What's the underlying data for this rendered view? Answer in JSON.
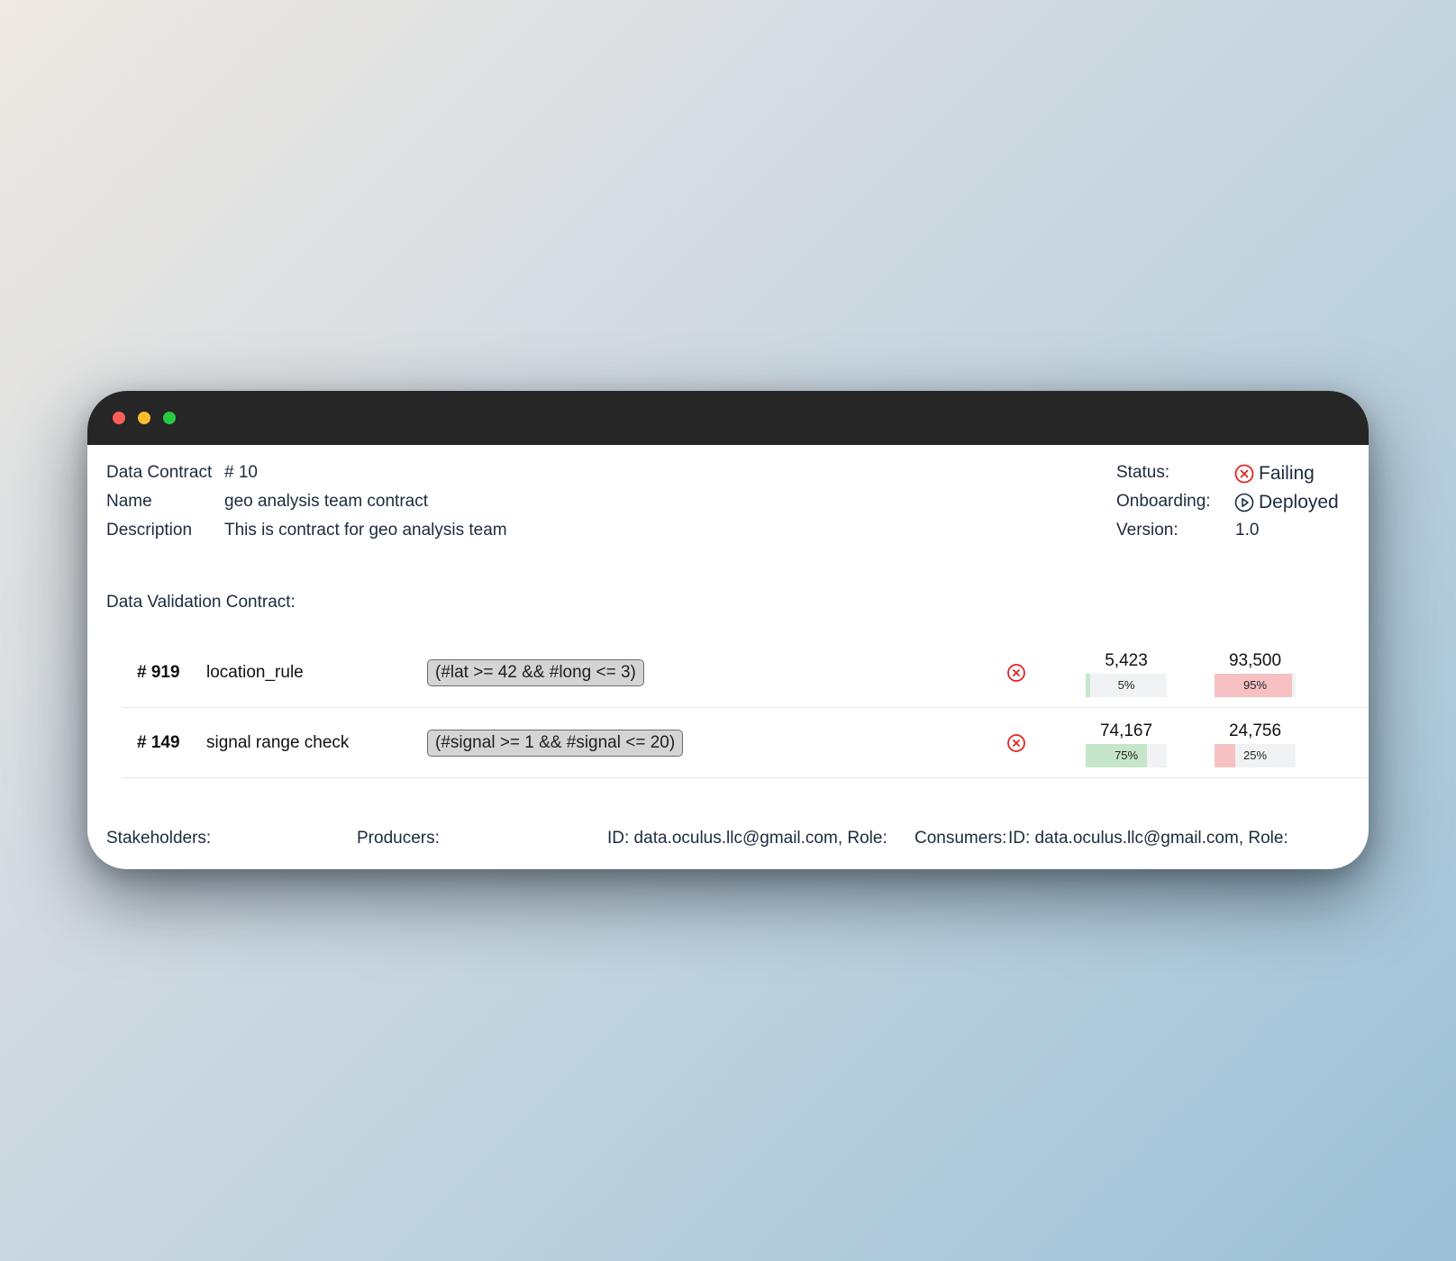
{
  "contract": {
    "title_label": "Data Contract",
    "number": "#  10",
    "name_label": "Name",
    "name_value": "geo analysis team contract",
    "description_label": "Description",
    "description_value": "This is contract for geo analysis team"
  },
  "status": {
    "status_label": "Status:",
    "status_value": "Failing",
    "onboarding_label": "Onboarding:",
    "onboarding_value": "Deployed",
    "version_label": "Version:",
    "version_value": "1.0",
    "colors": {
      "failing": "#e02424",
      "deployed": "#1e2b3d"
    }
  },
  "validation": {
    "section_label": "Data Validation Contract:",
    "rules": [
      {
        "id": "# 919",
        "name": "location_rule",
        "expression": "(#lat >= 42 && #long <= 3)",
        "icon": "failing-x-circle-icon",
        "passed_count": "5,423",
        "passed_pct": 5,
        "passed_pct_label": "5%",
        "failed_count": "93,500",
        "failed_pct": 95,
        "failed_pct_label": "95%"
      },
      {
        "id": "# 149",
        "name": "signal range check",
        "expression": "(#signal >= 1 && #signal <= 20)",
        "icon": "failing-x-circle-icon",
        "passed_count": "74,167",
        "passed_pct": 75,
        "passed_pct_label": "75%",
        "failed_count": "24,756",
        "failed_pct": 25,
        "failed_pct_label": "25%"
      }
    ]
  },
  "stakeholders": {
    "label": "Stakeholders:",
    "producers_label": "Producers:",
    "producers_value": "ID: data.oculus.llc@gmail.com, Role:",
    "consumers_label": "Consumers:",
    "consumers_value": "ID: data.oculus.llc@gmail.com, Role:"
  }
}
